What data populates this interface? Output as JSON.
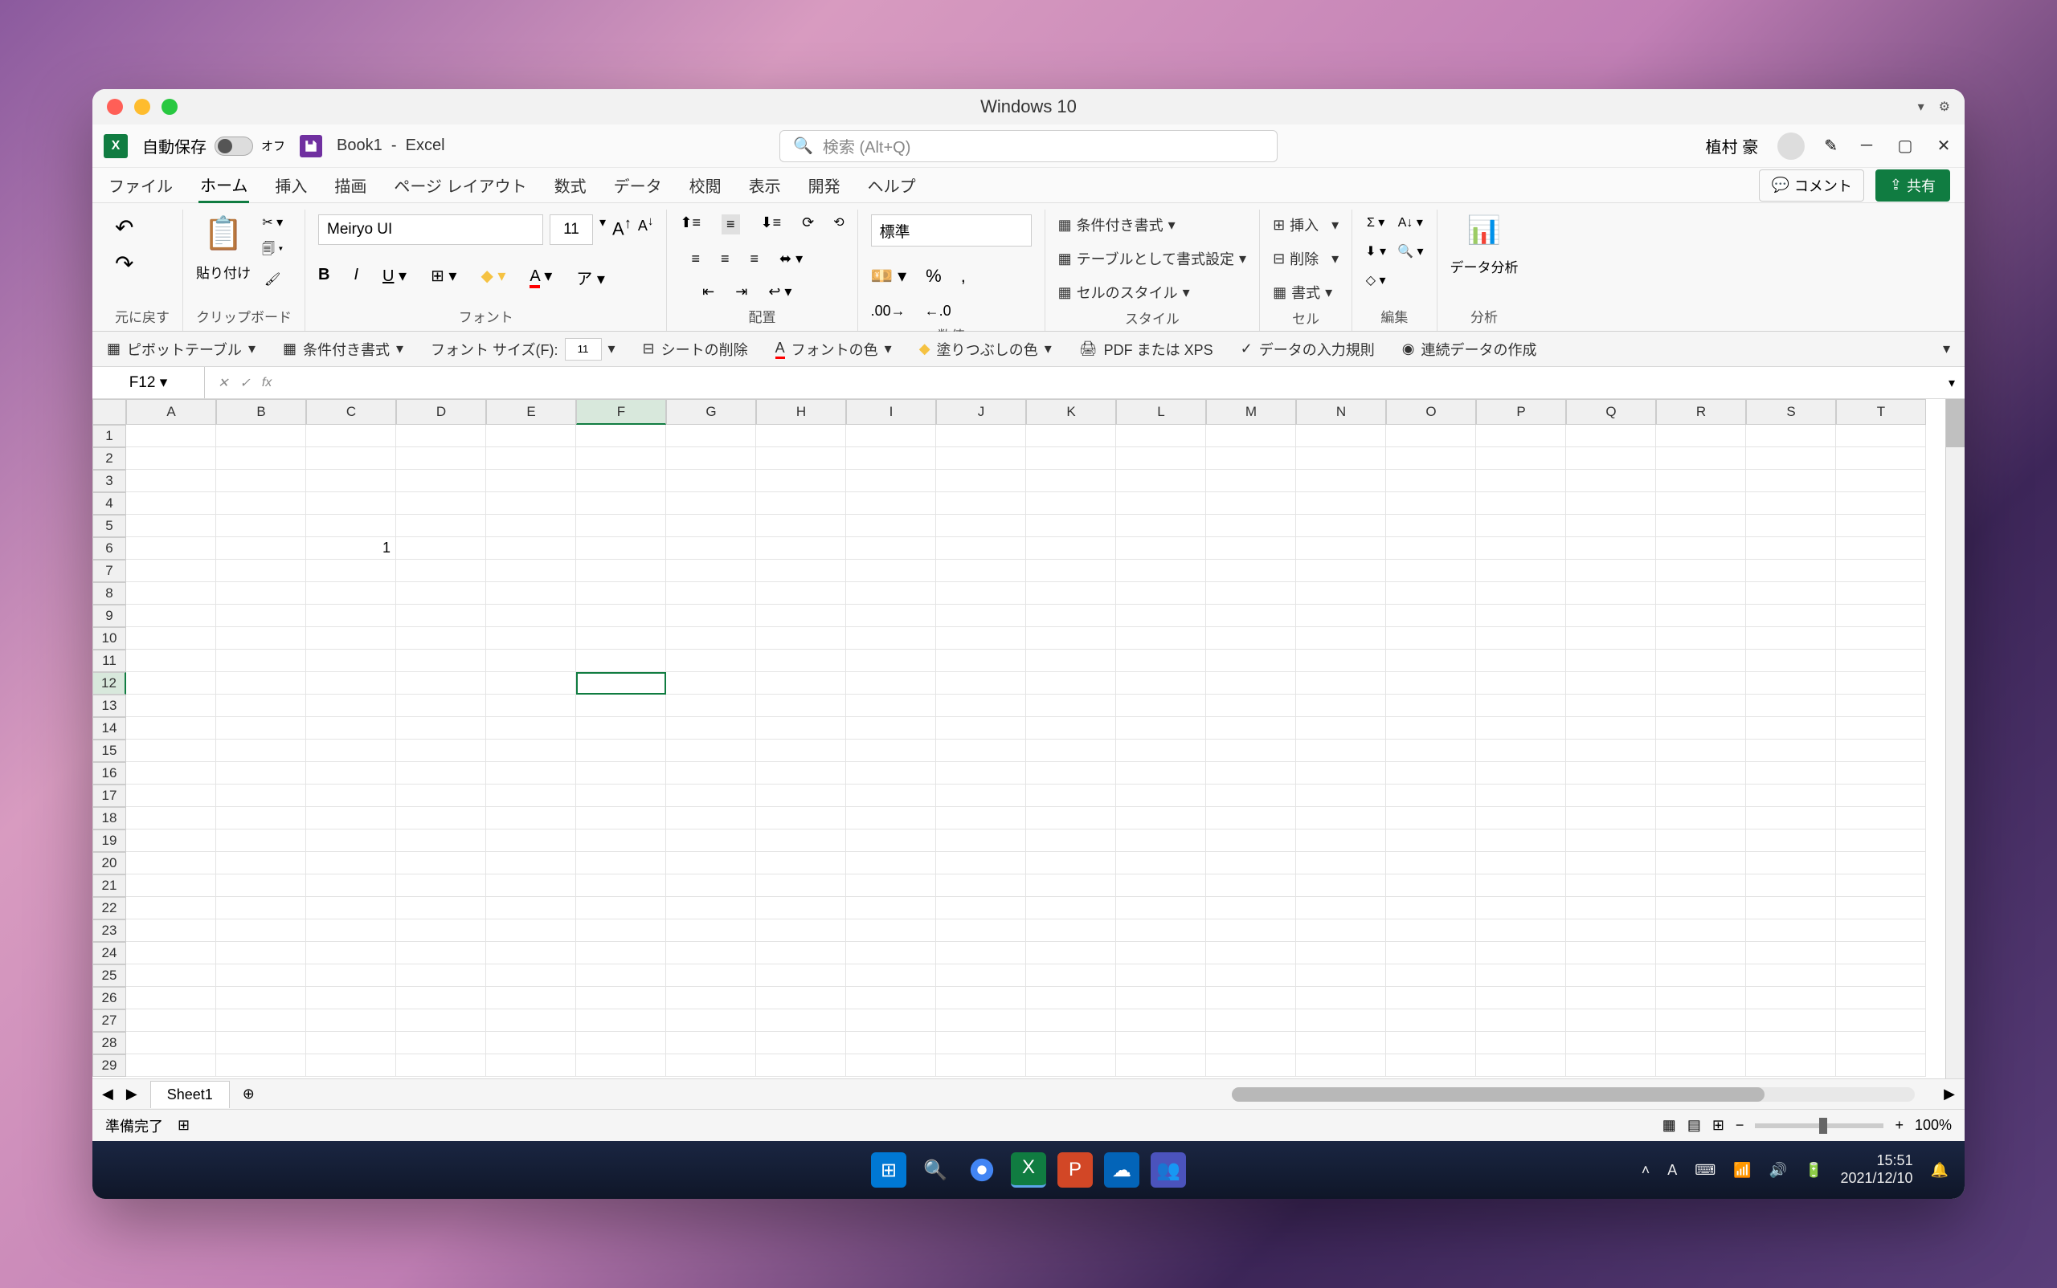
{
  "mac": {
    "title": "Windows 10"
  },
  "titlebar": {
    "autosave_label": "自動保存",
    "autosave_state": "オフ",
    "doc": "Book1",
    "app": "Excel",
    "search_placeholder": "検索 (Alt+Q)",
    "user": "植村 豪"
  },
  "tabs": [
    "ファイル",
    "ホーム",
    "挿入",
    "描画",
    "ページ レイアウト",
    "数式",
    "データ",
    "校閲",
    "表示",
    "開発",
    "ヘルプ"
  ],
  "tabs_active": 1,
  "right_tabs": {
    "comments": "コメント",
    "share": "共有"
  },
  "ribbon": {
    "undo_group": "元に戻す",
    "clipboard_group": "クリップボード",
    "paste": "貼り付け",
    "font_group": "フォント",
    "font_name": "Meiryo UI",
    "font_size": "11",
    "align_group": "配置",
    "number_group": "数値",
    "number_format": "標準",
    "styles_group": "スタイル",
    "cond_fmt": "条件付き書式",
    "table_fmt": "テーブルとして書式設定",
    "cell_styles": "セルのスタイル",
    "cells_group": "セル",
    "insert": "挿入",
    "delete": "削除",
    "format": "書式",
    "editing_group": "編集",
    "analysis_group": "分析",
    "analysis": "データ分析"
  },
  "qat": {
    "pivot": "ピボットテーブル",
    "cond_fmt": "条件付き書式",
    "font_size_label": "フォント サイズ(F):",
    "font_size_val": "11",
    "delete_sheet": "シートの削除",
    "font_color": "フォントの色",
    "fill_color": "塗りつぶしの色",
    "pdf": "PDF または XPS",
    "validation": "データの入力規則",
    "series": "連続データの作成"
  },
  "formula": {
    "cell_ref": "F12"
  },
  "grid": {
    "cols": [
      "A",
      "B",
      "C",
      "D",
      "E",
      "F",
      "G",
      "H",
      "I",
      "J",
      "K",
      "L",
      "M",
      "N",
      "O",
      "P",
      "Q",
      "R",
      "S",
      "T"
    ],
    "active_col": "F",
    "rows": 29,
    "active_row": 12,
    "cells": {
      "C6": "1"
    }
  },
  "sheets": {
    "name": "Sheet1"
  },
  "status": {
    "ready": "準備完了",
    "zoom": "100%"
  },
  "taskbar": {
    "time": "15:51",
    "date": "2021/12/10",
    "ime": "A"
  }
}
